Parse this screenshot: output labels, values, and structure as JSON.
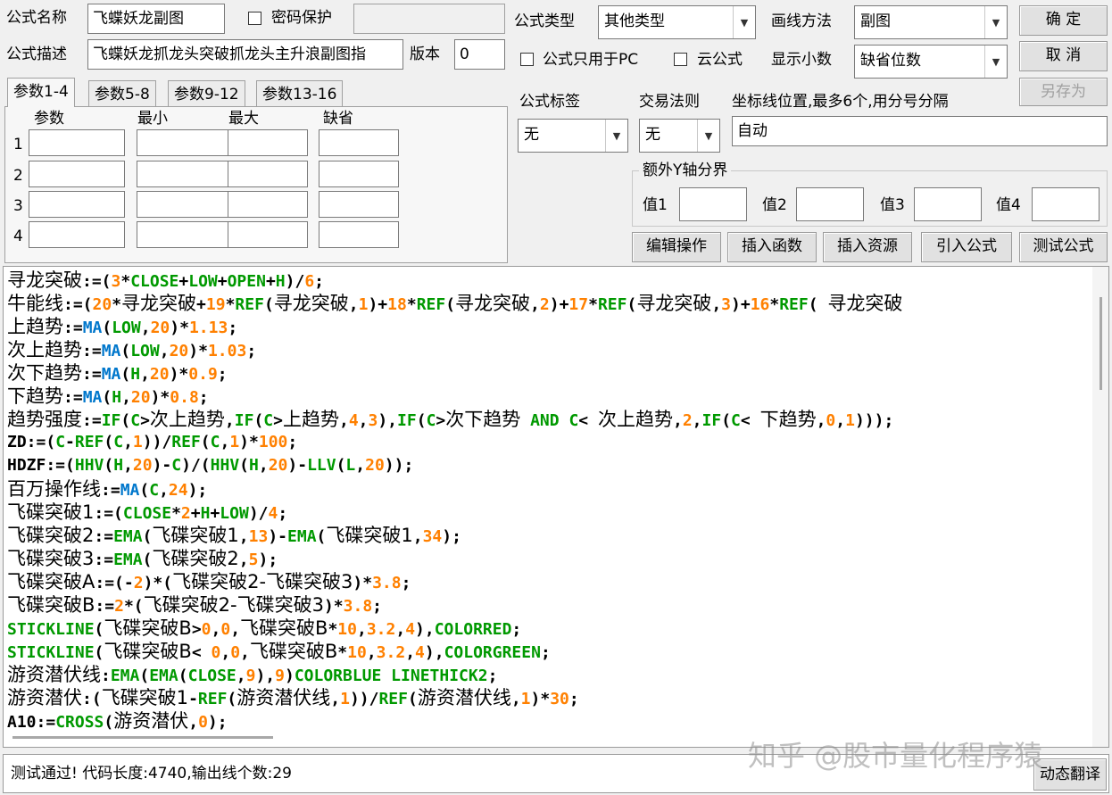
{
  "formula_name": {
    "label": "公式名称",
    "value": "飞蝶妖龙副图"
  },
  "password": {
    "label": "密码保护",
    "value": ""
  },
  "formula_desc": {
    "label": "公式描述",
    "value": "飞蝶妖龙抓龙头突破抓龙头主升浪副图指"
  },
  "version": {
    "label": "版本",
    "value": "0"
  },
  "formula_type": {
    "label": "公式类型",
    "value": "其他类型"
  },
  "draw_method": {
    "label": "画线方法",
    "value": "副图"
  },
  "pc_only": {
    "label": "公式只用于PC"
  },
  "cloud": {
    "label": "云公式"
  },
  "decimals": {
    "label": "显示小数",
    "value": "缺省位数"
  },
  "buttons": {
    "ok": "确 定",
    "cancel": "取 消",
    "save_as": "另存为"
  },
  "tabs": [
    "参数1-4",
    "参数5-8",
    "参数9-12",
    "参数13-16"
  ],
  "param_headers": [
    "参数",
    "最小",
    "最大",
    "缺省"
  ],
  "param_rows": [
    "1",
    "2",
    "3",
    "4"
  ],
  "formula_tag": {
    "label": "公式标签",
    "value": "无"
  },
  "trade_rule": {
    "label": "交易法则",
    "value": "无"
  },
  "coord": {
    "label": "坐标线位置,最多6个,用分号分隔",
    "value": "自动"
  },
  "y_axis": {
    "title": "额外Y轴分界",
    "labels": [
      "值1",
      "值2",
      "值3",
      "值4"
    ]
  },
  "actions": [
    "编辑操作",
    "插入函数",
    "插入资源",
    "引入公式",
    "测试公式"
  ],
  "code_lines": [
    [
      [
        "cn",
        "寻龙突破"
      ],
      [
        "o",
        ":=("
      ],
      [
        "n",
        "3"
      ],
      [
        "o",
        "*"
      ],
      [
        "k",
        "CLOSE"
      ],
      [
        "o",
        "+"
      ],
      [
        "k",
        "LOW"
      ],
      [
        "o",
        "+"
      ],
      [
        "k",
        "OPEN"
      ],
      [
        "o",
        "+"
      ],
      [
        "k",
        "H"
      ],
      [
        "o",
        ")/"
      ],
      [
        "n",
        "6"
      ],
      [
        "o",
        ";"
      ]
    ],
    [
      [
        "cn",
        "牛能线"
      ],
      [
        "o",
        ":=("
      ],
      [
        "n",
        "20"
      ],
      [
        "o",
        "*"
      ],
      [
        "cn",
        "寻龙突破"
      ],
      [
        "o",
        "+"
      ],
      [
        "n",
        "19"
      ],
      [
        "o",
        "*"
      ],
      [
        "k",
        "REF"
      ],
      [
        "o",
        "("
      ],
      [
        "cn",
        "寻龙突破"
      ],
      [
        "o",
        ","
      ],
      [
        "n",
        "1"
      ],
      [
        "o",
        ")+"
      ],
      [
        "n",
        "18"
      ],
      [
        "o",
        "*"
      ],
      [
        "k",
        "REF"
      ],
      [
        "o",
        "("
      ],
      [
        "cn",
        "寻龙突破"
      ],
      [
        "o",
        ","
      ],
      [
        "n",
        "2"
      ],
      [
        "o",
        ")+"
      ],
      [
        "n",
        "17"
      ],
      [
        "o",
        "*"
      ],
      [
        "k",
        "REF"
      ],
      [
        "o",
        "("
      ],
      [
        "cn",
        "寻龙突破"
      ],
      [
        "o",
        ","
      ],
      [
        "n",
        "3"
      ],
      [
        "o",
        ")+"
      ],
      [
        "n",
        "16"
      ],
      [
        "o",
        "*"
      ],
      [
        "k",
        "REF"
      ],
      [
        "o",
        "( "
      ],
      [
        "cn",
        "寻龙突破"
      ]
    ],
    [
      [
        "cn",
        "上趋势"
      ],
      [
        "o",
        ":="
      ],
      [
        "f",
        "MA"
      ],
      [
        "o",
        "("
      ],
      [
        "k",
        "LOW"
      ],
      [
        "o",
        ","
      ],
      [
        "n",
        "20"
      ],
      [
        "o",
        ")*"
      ],
      [
        "n",
        "1.13"
      ],
      [
        "o",
        ";"
      ]
    ],
    [
      [
        "cn",
        "次上趋势"
      ],
      [
        "o",
        ":="
      ],
      [
        "f",
        "MA"
      ],
      [
        "o",
        "("
      ],
      [
        "k",
        "LOW"
      ],
      [
        "o",
        ","
      ],
      [
        "n",
        "20"
      ],
      [
        "o",
        ")*"
      ],
      [
        "n",
        "1.03"
      ],
      [
        "o",
        ";"
      ]
    ],
    [
      [
        "cn",
        "次下趋势"
      ],
      [
        "o",
        ":="
      ],
      [
        "f",
        "MA"
      ],
      [
        "o",
        "("
      ],
      [
        "k",
        "H"
      ],
      [
        "o",
        ","
      ],
      [
        "n",
        "20"
      ],
      [
        "o",
        ")*"
      ],
      [
        "n",
        "0.9"
      ],
      [
        "o",
        ";"
      ]
    ],
    [
      [
        "cn",
        "下趋势"
      ],
      [
        "o",
        ":="
      ],
      [
        "f",
        "MA"
      ],
      [
        "o",
        "("
      ],
      [
        "k",
        "H"
      ],
      [
        "o",
        ","
      ],
      [
        "n",
        "20"
      ],
      [
        "o",
        ")*"
      ],
      [
        "n",
        "0.8"
      ],
      [
        "o",
        ";"
      ]
    ],
    [
      [
        "cn",
        "趋势强度"
      ],
      [
        "o",
        ":="
      ],
      [
        "k",
        "IF"
      ],
      [
        "o",
        "("
      ],
      [
        "k",
        "C"
      ],
      [
        "o",
        ">"
      ],
      [
        "cn",
        "次上趋势"
      ],
      [
        "o",
        ","
      ],
      [
        "k",
        "IF"
      ],
      [
        "o",
        "("
      ],
      [
        "k",
        "C"
      ],
      [
        "o",
        ">"
      ],
      [
        "cn",
        "上趋势"
      ],
      [
        "o",
        ","
      ],
      [
        "n",
        "4"
      ],
      [
        "o",
        ","
      ],
      [
        "n",
        "3"
      ],
      [
        "o",
        "),"
      ],
      [
        "k",
        "IF"
      ],
      [
        "o",
        "("
      ],
      [
        "k",
        "C"
      ],
      [
        "o",
        ">"
      ],
      [
        "cn",
        "次下趋势"
      ],
      [
        "o",
        " "
      ],
      [
        "k",
        "AND"
      ],
      [
        "o",
        " "
      ],
      [
        "k",
        "C"
      ],
      [
        "o",
        "< "
      ],
      [
        "cn",
        "次上趋势"
      ],
      [
        "o",
        ","
      ],
      [
        "n",
        "2"
      ],
      [
        "o",
        ","
      ],
      [
        "k",
        "IF"
      ],
      [
        "o",
        "("
      ],
      [
        "k",
        "C"
      ],
      [
        "o",
        "< "
      ],
      [
        "cn",
        "下趋势"
      ],
      [
        "o",
        ","
      ],
      [
        "n",
        "0"
      ],
      [
        "o",
        ","
      ],
      [
        "n",
        "1"
      ],
      [
        "o",
        ")));"
      ]
    ],
    [
      [
        "o",
        "ZD:=("
      ],
      [
        "k",
        "C"
      ],
      [
        "o",
        "-"
      ],
      [
        "k",
        "REF"
      ],
      [
        "o",
        "("
      ],
      [
        "k",
        "C"
      ],
      [
        "o",
        ","
      ],
      [
        "n",
        "1"
      ],
      [
        "o",
        "))/"
      ],
      [
        "k",
        "REF"
      ],
      [
        "o",
        "("
      ],
      [
        "k",
        "C"
      ],
      [
        "o",
        ","
      ],
      [
        "n",
        "1"
      ],
      [
        "o",
        ")*"
      ],
      [
        "n",
        "100"
      ],
      [
        "o",
        ";"
      ]
    ],
    [
      [
        "o",
        "HDZF:=("
      ],
      [
        "k",
        "HHV"
      ],
      [
        "o",
        "("
      ],
      [
        "k",
        "H"
      ],
      [
        "o",
        ","
      ],
      [
        "n",
        "20"
      ],
      [
        "o",
        ")-"
      ],
      [
        "k",
        "C"
      ],
      [
        "o",
        ")/("
      ],
      [
        "k",
        "HHV"
      ],
      [
        "o",
        "("
      ],
      [
        "k",
        "H"
      ],
      [
        "o",
        ","
      ],
      [
        "n",
        "20"
      ],
      [
        "o",
        ")-"
      ],
      [
        "k",
        "LLV"
      ],
      [
        "o",
        "("
      ],
      [
        "k",
        "L"
      ],
      [
        "o",
        ","
      ],
      [
        "n",
        "20"
      ],
      [
        "o",
        "));"
      ]
    ],
    [
      [
        "cn",
        "百万操作线"
      ],
      [
        "o",
        ":="
      ],
      [
        "f",
        "MA"
      ],
      [
        "o",
        "("
      ],
      [
        "k",
        "C"
      ],
      [
        "o",
        ","
      ],
      [
        "n",
        "24"
      ],
      [
        "o",
        ");"
      ]
    ],
    [
      [
        "cn",
        "飞碟突破1"
      ],
      [
        "o",
        ":=("
      ],
      [
        "k",
        "CLOSE"
      ],
      [
        "o",
        "*"
      ],
      [
        "n",
        "2"
      ],
      [
        "o",
        "+"
      ],
      [
        "k",
        "H"
      ],
      [
        "o",
        "+"
      ],
      [
        "k",
        "LOW"
      ],
      [
        "o",
        ")/"
      ],
      [
        "n",
        "4"
      ],
      [
        "o",
        ";"
      ]
    ],
    [
      [
        "cn",
        "飞碟突破2"
      ],
      [
        "o",
        ":="
      ],
      [
        "k",
        "EMA"
      ],
      [
        "o",
        "("
      ],
      [
        "cn",
        "飞碟突破1"
      ],
      [
        "o",
        ","
      ],
      [
        "n",
        "13"
      ],
      [
        "o",
        ")-"
      ],
      [
        "k",
        "EMA"
      ],
      [
        "o",
        "("
      ],
      [
        "cn",
        "飞碟突破1"
      ],
      [
        "o",
        ","
      ],
      [
        "n",
        "34"
      ],
      [
        "o",
        ");"
      ]
    ],
    [
      [
        "cn",
        "飞碟突破3"
      ],
      [
        "o",
        ":="
      ],
      [
        "k",
        "EMA"
      ],
      [
        "o",
        "("
      ],
      [
        "cn",
        "飞碟突破2"
      ],
      [
        "o",
        ","
      ],
      [
        "n",
        "5"
      ],
      [
        "o",
        ");"
      ]
    ],
    [
      [
        "cn",
        "飞碟突破A"
      ],
      [
        "o",
        ":=(-"
      ],
      [
        "n",
        "2"
      ],
      [
        "o",
        ")*("
      ],
      [
        "cn",
        "飞碟突破2-飞碟突破3"
      ],
      [
        "o",
        ")*"
      ],
      [
        "n",
        "3.8"
      ],
      [
        "o",
        ";"
      ]
    ],
    [
      [
        "cn",
        "飞碟突破B"
      ],
      [
        "o",
        ":="
      ],
      [
        "n",
        "2"
      ],
      [
        "o",
        "*("
      ],
      [
        "cn",
        "飞碟突破2-飞碟突破3"
      ],
      [
        "o",
        ")*"
      ],
      [
        "n",
        "3.8"
      ],
      [
        "o",
        ";"
      ]
    ],
    [
      [
        "k",
        "STICKLINE"
      ],
      [
        "o",
        "("
      ],
      [
        "cn",
        "飞碟突破B"
      ],
      [
        "o",
        ">"
      ],
      [
        "n",
        "0"
      ],
      [
        "o",
        ","
      ],
      [
        "n",
        "0"
      ],
      [
        "o",
        ","
      ],
      [
        "cn",
        "飞碟突破B"
      ],
      [
        "o",
        "*"
      ],
      [
        "n",
        "10"
      ],
      [
        "o",
        ","
      ],
      [
        "n",
        "3.2"
      ],
      [
        "o",
        ","
      ],
      [
        "n",
        "4"
      ],
      [
        "o",
        "),"
      ],
      [
        "k",
        "COLORRED"
      ],
      [
        "o",
        ";"
      ]
    ],
    [
      [
        "k",
        "STICKLINE"
      ],
      [
        "o",
        "("
      ],
      [
        "cn",
        "飞碟突破B"
      ],
      [
        "o",
        "< "
      ],
      [
        "n",
        "0"
      ],
      [
        "o",
        ","
      ],
      [
        "n",
        "0"
      ],
      [
        "o",
        ","
      ],
      [
        "cn",
        "飞碟突破B"
      ],
      [
        "o",
        "*"
      ],
      [
        "n",
        "10"
      ],
      [
        "o",
        ","
      ],
      [
        "n",
        "3.2"
      ],
      [
        "o",
        ","
      ],
      [
        "n",
        "4"
      ],
      [
        "o",
        "),"
      ],
      [
        "k",
        "COLORGREEN"
      ],
      [
        "o",
        ";"
      ]
    ],
    [
      [
        "cn",
        "游资潜伏线"
      ],
      [
        "o",
        ":"
      ],
      [
        "k",
        "EMA"
      ],
      [
        "o",
        "("
      ],
      [
        "k",
        "EMA"
      ],
      [
        "o",
        "("
      ],
      [
        "k",
        "CLOSE"
      ],
      [
        "o",
        ","
      ],
      [
        "n",
        "9"
      ],
      [
        "o",
        "),"
      ],
      [
        "n",
        "9"
      ],
      [
        "o",
        ")"
      ],
      [
        "k",
        "COLORBLUE LINETHICK2"
      ],
      [
        "o",
        ";"
      ]
    ],
    [
      [
        "cn",
        "游资潜伏"
      ],
      [
        "o",
        ":("
      ],
      [
        "cn",
        "飞碟突破1"
      ],
      [
        "o",
        "-"
      ],
      [
        "k",
        "REF"
      ],
      [
        "o",
        "("
      ],
      [
        "cn",
        "游资潜伏线"
      ],
      [
        "o",
        ","
      ],
      [
        "n",
        "1"
      ],
      [
        "o",
        "))/"
      ],
      [
        "k",
        "REF"
      ],
      [
        "o",
        "("
      ],
      [
        "cn",
        "游资潜伏线"
      ],
      [
        "o",
        ","
      ],
      [
        "n",
        "1"
      ],
      [
        "o",
        ")*"
      ],
      [
        "n",
        "30"
      ],
      [
        "o",
        ";"
      ]
    ],
    [
      [
        "o",
        "A10:="
      ],
      [
        "k",
        "CROSS"
      ],
      [
        "o",
        "("
      ],
      [
        "cn",
        "游资潜伏"
      ],
      [
        "o",
        ","
      ],
      [
        "n",
        "0"
      ],
      [
        "o",
        ");"
      ]
    ]
  ],
  "status_text": "测试通过! 代码长度:4740,输出线个数:29",
  "dynamic_translate": "动态翻译",
  "watermark": "知乎 @股市量化程序猿"
}
